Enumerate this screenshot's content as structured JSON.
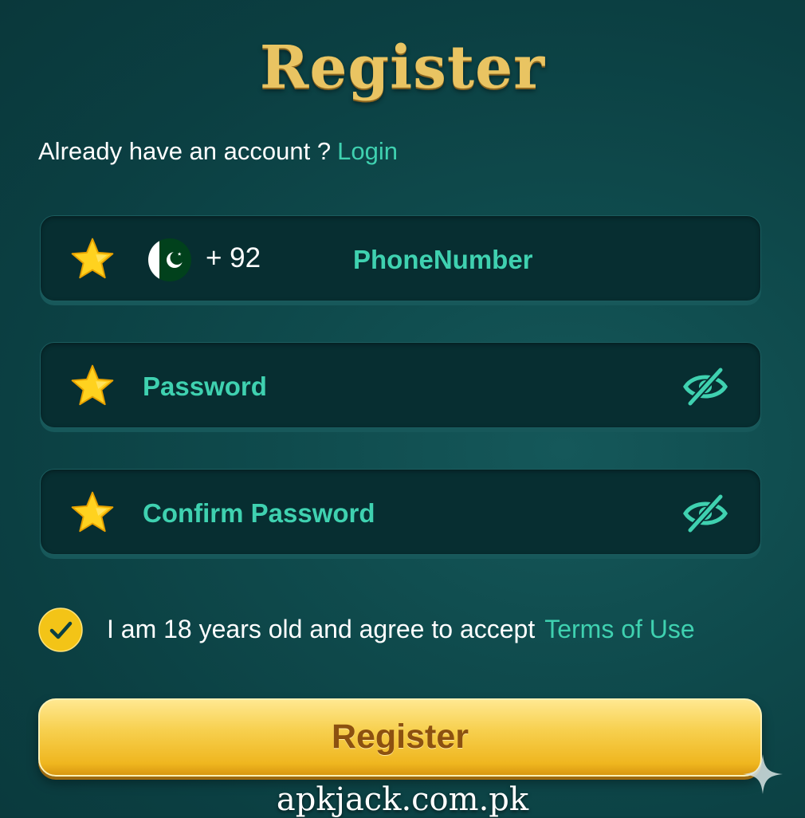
{
  "header": {
    "title": "Register"
  },
  "login_prompt": {
    "text": "Already have an account ?",
    "link": "Login"
  },
  "form": {
    "phone": {
      "required_icon": "star-icon",
      "country_flag": "pakistan-flag-icon",
      "dial_code": "+ 92",
      "placeholder": "PhoneNumber"
    },
    "password": {
      "required_icon": "star-icon",
      "placeholder": "Password",
      "toggle_icon": "eye-off-icon"
    },
    "confirm_password": {
      "required_icon": "star-icon",
      "placeholder": "Confirm Password",
      "toggle_icon": "eye-off-icon"
    }
  },
  "agreement": {
    "checked": true,
    "text": "I am 18 years old and agree to accept",
    "link": "Terms of Use"
  },
  "register_button": {
    "label": "Register"
  },
  "watermark": {
    "text": "apkjack.com.pk"
  },
  "colors": {
    "background": "#0f4b4d",
    "field_background": "#072e31",
    "accent_teal": "#3fd1b0",
    "gold": "#f7d04f",
    "title_gold": "#e9c462",
    "button_text": "#8c5110"
  }
}
